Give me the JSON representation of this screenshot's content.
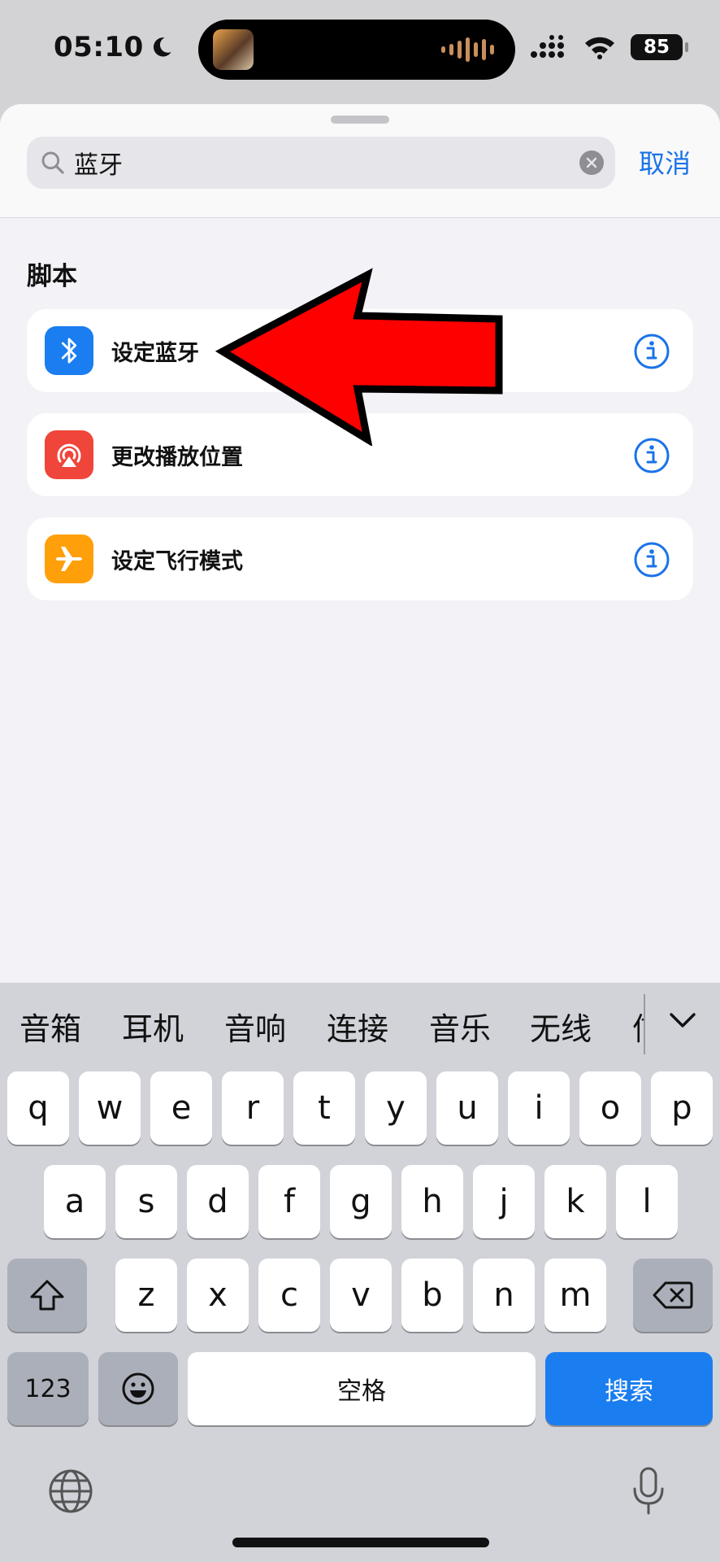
{
  "status_bar": {
    "time": "05:10",
    "battery": "85"
  },
  "search": {
    "value": "蓝牙",
    "cancel_label": "取消"
  },
  "section": {
    "title": "脚本"
  },
  "results": [
    {
      "label": "设定蓝牙",
      "icon": "bluetooth-icon",
      "color": "#1a7df0"
    },
    {
      "label": "更改播放位置",
      "icon": "airplay-icon",
      "color": "#f0453a"
    },
    {
      "label": "设定飞行模式",
      "icon": "airplane-icon",
      "color": "#ff9f0a"
    }
  ],
  "keyboard": {
    "candidates": [
      "音箱",
      "耳机",
      "音响",
      "连接",
      "音乐",
      "无线",
      "信"
    ],
    "row1": [
      "q",
      "w",
      "e",
      "r",
      "t",
      "y",
      "u",
      "i",
      "o",
      "p"
    ],
    "row2": [
      "a",
      "s",
      "d",
      "f",
      "g",
      "h",
      "j",
      "k",
      "l"
    ],
    "row3": [
      "z",
      "x",
      "c",
      "v",
      "b",
      "n",
      "m"
    ],
    "numbers_label": "123",
    "space_label": "空格",
    "search_label": "搜索"
  },
  "colors": {
    "accent": "#1a73e8",
    "arrow": "#ff0000"
  }
}
